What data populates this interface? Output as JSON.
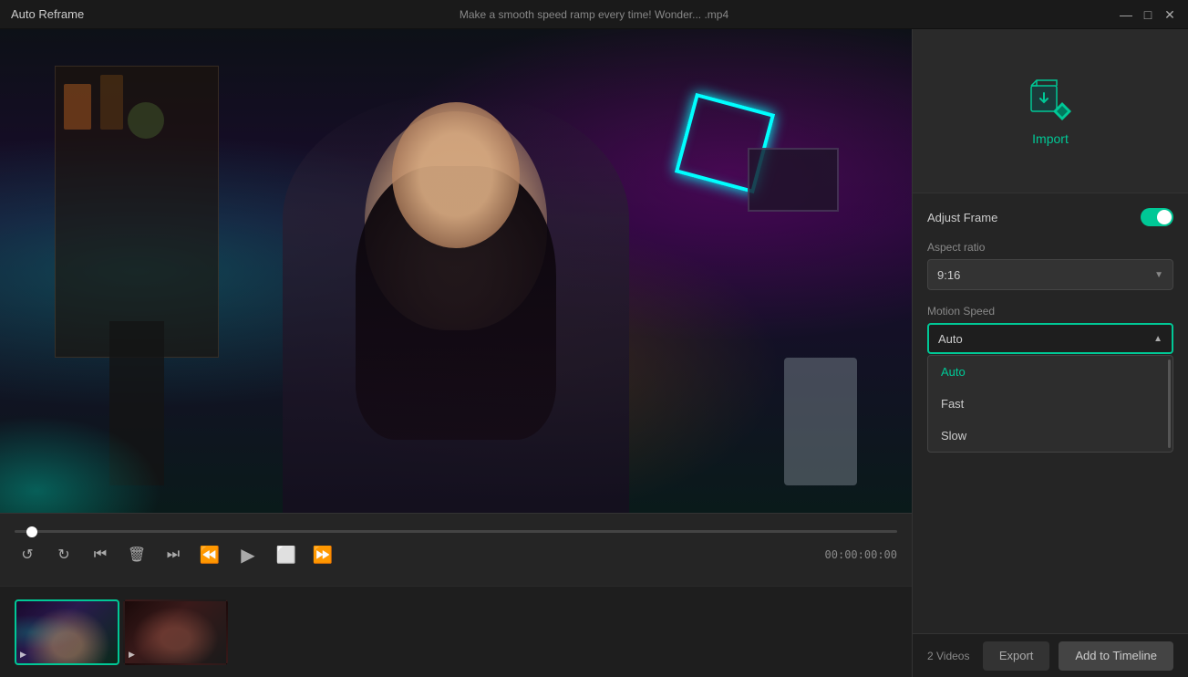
{
  "titlebar": {
    "title": "Auto Reframe",
    "filename": "Make a smooth speed ramp every time!  Wonder... .mp4",
    "controls": {
      "minimize": "—",
      "maximize": "□",
      "close": "✕"
    }
  },
  "video": {
    "time": "00:00:00:00"
  },
  "controls": {
    "undo": "↺",
    "redo": "↻",
    "skip_back": "⏮",
    "delete": "🗑",
    "skip_forward": "⏭",
    "prev_frame": "⏪",
    "play": "▶",
    "square": "⬜",
    "next_frame": "⏩"
  },
  "thumbnails": {
    "count_label": "2 Videos"
  },
  "right_panel": {
    "import_label": "Import",
    "adjust_frame": {
      "title": "Adjust Frame",
      "toggle_on": true,
      "aspect_ratio_label": "Aspect ratio",
      "aspect_ratio_value": "9:16",
      "motion_speed_label": "Motion Speed",
      "motion_speed_value": "Auto"
    },
    "dropdown": {
      "options": [
        {
          "label": "Auto",
          "selected": true
        },
        {
          "label": "Fast",
          "selected": false
        },
        {
          "label": "Slow",
          "selected": false
        }
      ]
    }
  },
  "bottom_bar": {
    "video_count": "2 Videos",
    "export_label": "Export",
    "add_timeline_label": "Add to Timeline"
  }
}
